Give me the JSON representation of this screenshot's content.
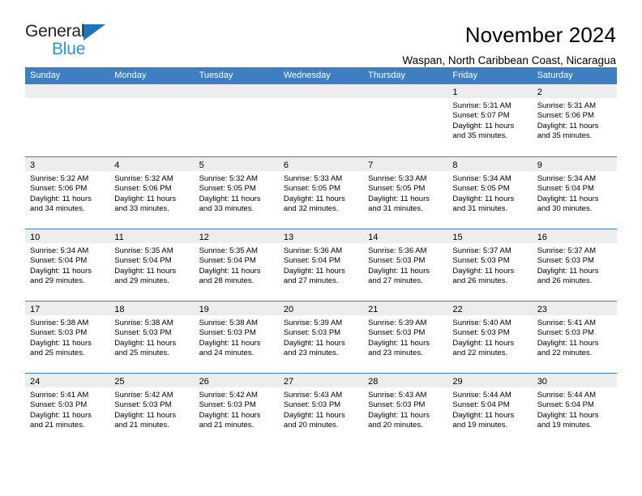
{
  "brand": {
    "name_part1": "General",
    "name_part2": "Blue",
    "triangle_icon": "triangle-icon",
    "accent_color": "#1b75bb",
    "light_accent_color": "#2a95d5"
  },
  "header": {
    "title": "November 2024",
    "subtitle": "Waspan, North Caribbean Coast, Nicaragua"
  },
  "calendar": {
    "header_bg": "#3d7fc1",
    "day_strip_bg": "#ededed",
    "weekdays": [
      "Sunday",
      "Monday",
      "Tuesday",
      "Wednesday",
      "Thursday",
      "Friday",
      "Saturday"
    ],
    "weeks": [
      [
        {
          "day": "",
          "empty": true
        },
        {
          "day": "",
          "empty": true
        },
        {
          "day": "",
          "empty": true
        },
        {
          "day": "",
          "empty": true
        },
        {
          "day": "",
          "empty": true
        },
        {
          "day": "1",
          "sunrise": "Sunrise: 5:31 AM",
          "sunset": "Sunset: 5:07 PM",
          "daylight1": "Daylight: 11 hours",
          "daylight2": "and 35 minutes."
        },
        {
          "day": "2",
          "sunrise": "Sunrise: 5:31 AM",
          "sunset": "Sunset: 5:06 PM",
          "daylight1": "Daylight: 11 hours",
          "daylight2": "and 35 minutes."
        }
      ],
      [
        {
          "day": "3",
          "sunrise": "Sunrise: 5:32 AM",
          "sunset": "Sunset: 5:06 PM",
          "daylight1": "Daylight: 11 hours",
          "daylight2": "and 34 minutes."
        },
        {
          "day": "4",
          "sunrise": "Sunrise: 5:32 AM",
          "sunset": "Sunset: 5:06 PM",
          "daylight1": "Daylight: 11 hours",
          "daylight2": "and 33 minutes."
        },
        {
          "day": "5",
          "sunrise": "Sunrise: 5:32 AM",
          "sunset": "Sunset: 5:05 PM",
          "daylight1": "Daylight: 11 hours",
          "daylight2": "and 33 minutes."
        },
        {
          "day": "6",
          "sunrise": "Sunrise: 5:33 AM",
          "sunset": "Sunset: 5:05 PM",
          "daylight1": "Daylight: 11 hours",
          "daylight2": "and 32 minutes."
        },
        {
          "day": "7",
          "sunrise": "Sunrise: 5:33 AM",
          "sunset": "Sunset: 5:05 PM",
          "daylight1": "Daylight: 11 hours",
          "daylight2": "and 31 minutes."
        },
        {
          "day": "8",
          "sunrise": "Sunrise: 5:34 AM",
          "sunset": "Sunset: 5:05 PM",
          "daylight1": "Daylight: 11 hours",
          "daylight2": "and 31 minutes."
        },
        {
          "day": "9",
          "sunrise": "Sunrise: 5:34 AM",
          "sunset": "Sunset: 5:04 PM",
          "daylight1": "Daylight: 11 hours",
          "daylight2": "and 30 minutes."
        }
      ],
      [
        {
          "day": "10",
          "sunrise": "Sunrise: 5:34 AM",
          "sunset": "Sunset: 5:04 PM",
          "daylight1": "Daylight: 11 hours",
          "daylight2": "and 29 minutes."
        },
        {
          "day": "11",
          "sunrise": "Sunrise: 5:35 AM",
          "sunset": "Sunset: 5:04 PM",
          "daylight1": "Daylight: 11 hours",
          "daylight2": "and 29 minutes."
        },
        {
          "day": "12",
          "sunrise": "Sunrise: 5:35 AM",
          "sunset": "Sunset: 5:04 PM",
          "daylight1": "Daylight: 11 hours",
          "daylight2": "and 28 minutes."
        },
        {
          "day": "13",
          "sunrise": "Sunrise: 5:36 AM",
          "sunset": "Sunset: 5:04 PM",
          "daylight1": "Daylight: 11 hours",
          "daylight2": "and 27 minutes."
        },
        {
          "day": "14",
          "sunrise": "Sunrise: 5:36 AM",
          "sunset": "Sunset: 5:03 PM",
          "daylight1": "Daylight: 11 hours",
          "daylight2": "and 27 minutes."
        },
        {
          "day": "15",
          "sunrise": "Sunrise: 5:37 AM",
          "sunset": "Sunset: 5:03 PM",
          "daylight1": "Daylight: 11 hours",
          "daylight2": "and 26 minutes."
        },
        {
          "day": "16",
          "sunrise": "Sunrise: 5:37 AM",
          "sunset": "Sunset: 5:03 PM",
          "daylight1": "Daylight: 11 hours",
          "daylight2": "and 26 minutes."
        }
      ],
      [
        {
          "day": "17",
          "sunrise": "Sunrise: 5:38 AM",
          "sunset": "Sunset: 5:03 PM",
          "daylight1": "Daylight: 11 hours",
          "daylight2": "and 25 minutes."
        },
        {
          "day": "18",
          "sunrise": "Sunrise: 5:38 AM",
          "sunset": "Sunset: 5:03 PM",
          "daylight1": "Daylight: 11 hours",
          "daylight2": "and 25 minutes."
        },
        {
          "day": "19",
          "sunrise": "Sunrise: 5:38 AM",
          "sunset": "Sunset: 5:03 PM",
          "daylight1": "Daylight: 11 hours",
          "daylight2": "and 24 minutes."
        },
        {
          "day": "20",
          "sunrise": "Sunrise: 5:39 AM",
          "sunset": "Sunset: 5:03 PM",
          "daylight1": "Daylight: 11 hours",
          "daylight2": "and 23 minutes."
        },
        {
          "day": "21",
          "sunrise": "Sunrise: 5:39 AM",
          "sunset": "Sunset: 5:03 PM",
          "daylight1": "Daylight: 11 hours",
          "daylight2": "and 23 minutes."
        },
        {
          "day": "22",
          "sunrise": "Sunrise: 5:40 AM",
          "sunset": "Sunset: 5:03 PM",
          "daylight1": "Daylight: 11 hours",
          "daylight2": "and 22 minutes."
        },
        {
          "day": "23",
          "sunrise": "Sunrise: 5:41 AM",
          "sunset": "Sunset: 5:03 PM",
          "daylight1": "Daylight: 11 hours",
          "daylight2": "and 22 minutes."
        }
      ],
      [
        {
          "day": "24",
          "sunrise": "Sunrise: 5:41 AM",
          "sunset": "Sunset: 5:03 PM",
          "daylight1": "Daylight: 11 hours",
          "daylight2": "and 21 minutes."
        },
        {
          "day": "25",
          "sunrise": "Sunrise: 5:42 AM",
          "sunset": "Sunset: 5:03 PM",
          "daylight1": "Daylight: 11 hours",
          "daylight2": "and 21 minutes."
        },
        {
          "day": "26",
          "sunrise": "Sunrise: 5:42 AM",
          "sunset": "Sunset: 5:03 PM",
          "daylight1": "Daylight: 11 hours",
          "daylight2": "and 21 minutes."
        },
        {
          "day": "27",
          "sunrise": "Sunrise: 5:43 AM",
          "sunset": "Sunset: 5:03 PM",
          "daylight1": "Daylight: 11 hours",
          "daylight2": "and 20 minutes."
        },
        {
          "day": "28",
          "sunrise": "Sunrise: 5:43 AM",
          "sunset": "Sunset: 5:03 PM",
          "daylight1": "Daylight: 11 hours",
          "daylight2": "and 20 minutes."
        },
        {
          "day": "29",
          "sunrise": "Sunrise: 5:44 AM",
          "sunset": "Sunset: 5:04 PM",
          "daylight1": "Daylight: 11 hours",
          "daylight2": "and 19 minutes."
        },
        {
          "day": "30",
          "sunrise": "Sunrise: 5:44 AM",
          "sunset": "Sunset: 5:04 PM",
          "daylight1": "Daylight: 11 hours",
          "daylight2": "and 19 minutes."
        }
      ]
    ]
  }
}
